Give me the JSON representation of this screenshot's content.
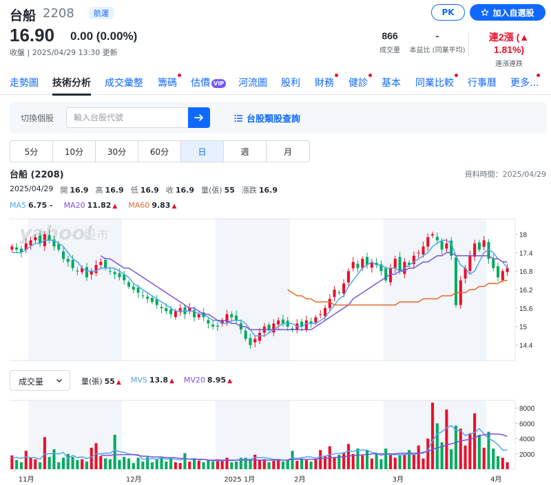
{
  "header": {
    "name": "台船",
    "code": "2208",
    "sector": "航運",
    "price": "16.90",
    "change": "0.00 (0.00%)",
    "close_time": "收盤 | 2025/04/29 13:30 更新",
    "pk_label": "PK",
    "watchlist_label": "加入自選股",
    "stats": [
      {
        "value": "866",
        "label": "成交量"
      },
      {
        "value": "-",
        "label": "本益比 (同業平均)"
      },
      {
        "value": "連2漲 (▲ 1.81%)",
        "label": "連漲連跌"
      }
    ]
  },
  "tabs": [
    {
      "label": "走勢圖",
      "dot": false
    },
    {
      "label": "技術分析",
      "dot": false,
      "active": true
    },
    {
      "label": "成交彙整",
      "dot": false
    },
    {
      "label": "籌碼",
      "dot": true
    },
    {
      "label": "估價",
      "dot": false,
      "vip": "VIP"
    },
    {
      "label": "河流圖",
      "dot": false
    },
    {
      "label": "股利",
      "dot": false
    },
    {
      "label": "財務",
      "dot": true
    },
    {
      "label": "健診",
      "dot": true
    },
    {
      "label": "基本",
      "dot": false
    },
    {
      "label": "同業比較",
      "dot": true
    },
    {
      "label": "行事曆",
      "dot": false
    },
    {
      "label": "更多...",
      "dot": true
    }
  ],
  "search": {
    "label": "切換個股",
    "placeholder": "輸入台股代號",
    "category_link": "台股類股查詢"
  },
  "periods": [
    {
      "label": "5分"
    },
    {
      "label": "10分"
    },
    {
      "label": "30分"
    },
    {
      "label": "60分"
    },
    {
      "label": "日",
      "active": true
    },
    {
      "label": "週"
    },
    {
      "label": "月"
    }
  ],
  "chart_header": {
    "title": "台船 (2208)",
    "data_time": "資料時間：2025/04/29",
    "date": "2025/04/29",
    "open_label": "開",
    "open": "16.9",
    "high_label": "高",
    "high": "16.9",
    "low_label": "低",
    "low": "16.9",
    "close_label": "收",
    "close": "16.9",
    "vol_label": "量(張)",
    "vol": "55",
    "chg_label": "漲跌",
    "chg": "16.9",
    "ma5_label": "MA5",
    "ma5": "6.75 -",
    "ma20_label": "MA20",
    "ma20": "11.82",
    "ma60_label": "MA60",
    "ma60": "9.83",
    "up_arrow": "▲"
  },
  "volume_header": {
    "select_label": "成交量",
    "vol_label": "量(張)",
    "vol": "55",
    "mv5_label": "MV5",
    "mv5": "13.8",
    "mv20_label": "MV20",
    "mv20": "8.95"
  },
  "watermark": {
    "brand": "yahoo!",
    "sub": "股市"
  },
  "colors": {
    "up": "#eb0f29",
    "down": "#00ab5e",
    "ma5": "#4fa4f1",
    "ma20": "#7b52d8",
    "ma60": "#e2672c",
    "accent": "#0f69ff"
  },
  "chart_data": [
    {
      "type": "candlestick",
      "title": "台船 (2208)",
      "x_ticks": [
        "11月",
        "12月",
        "2025 1月",
        "2月",
        "3月",
        "4月"
      ],
      "y_ticks": [
        14.4,
        15,
        15.6,
        16.2,
        16.8,
        17.4,
        18
      ],
      "ylim": [
        13.9,
        18.5
      ],
      "close": [
        17.6,
        17.5,
        17.4,
        17.7,
        17.8,
        17.9,
        17.7,
        18.0,
        17.8,
        17.6,
        17.5,
        17.2,
        17.1,
        16.9,
        16.8,
        16.9,
        16.6,
        16.8,
        17.0,
        17.1,
        16.9,
        16.8,
        16.7,
        16.6,
        16.5,
        16.3,
        16.2,
        16.1,
        16.0,
        15.9,
        15.8,
        15.7,
        15.6,
        15.5,
        15.4,
        15.5,
        15.6,
        15.4,
        15.6,
        15.3,
        15.4,
        15.3,
        15.1,
        15.0,
        15.0,
        15.2,
        15.4,
        15.3,
        15.2,
        14.9,
        14.6,
        14.4,
        14.6,
        14.8,
        15.0,
        14.9,
        15.1,
        15.2,
        15.1,
        15.0,
        14.9,
        15.1,
        15.0,
        15.2,
        15.1,
        15.3,
        15.4,
        15.6,
        15.9,
        16.2,
        16.1,
        16.4,
        16.8,
        17.1,
        16.9,
        17.2,
        17.0,
        17.1,
        17.0,
        16.8,
        16.5,
        16.9,
        17.2,
        16.8,
        17.1,
        17.0,
        17.3,
        17.4,
        17.6,
        17.9,
        18.0,
        17.8,
        17.5,
        17.7,
        17.3,
        15.7,
        16.5,
        16.9,
        17.3,
        17.7,
        17.5,
        17.8,
        17.2,
        16.9,
        16.6,
        16.8,
        16.9
      ],
      "series": [
        {
          "name": "MA5",
          "values": [
            17.4,
            17.4,
            17.4,
            17.5,
            17.6,
            17.7,
            17.7,
            17.8,
            17.8,
            17.8,
            17.7,
            17.6,
            17.4,
            17.2,
            17.1,
            16.9,
            16.8,
            16.8,
            16.8,
            16.9,
            16.9,
            16.9,
            16.9,
            16.8,
            16.7,
            16.6,
            16.4,
            16.3,
            16.2,
            16.1,
            16.0,
            15.9,
            15.8,
            15.7,
            15.6,
            15.5,
            15.5,
            15.5,
            15.5,
            15.5,
            15.4,
            15.4,
            15.3,
            15.2,
            15.2,
            15.1,
            15.1,
            15.2,
            15.2,
            15.2,
            15.1,
            14.9,
            14.7,
            14.7,
            14.7,
            14.8,
            14.9,
            15.0,
            15.1,
            15.1,
            15.1,
            15.0,
            15.0,
            15.1,
            15.1,
            15.1,
            15.2,
            15.3,
            15.5,
            15.7,
            15.9,
            16.0,
            16.3,
            16.5,
            16.7,
            16.9,
            17.0,
            17.1,
            17.0,
            17.0,
            16.9,
            16.9,
            16.9,
            16.8,
            16.9,
            17.0,
            17.1,
            17.2,
            17.3,
            17.4,
            17.6,
            17.7,
            17.8,
            17.8,
            17.7,
            17.3,
            17.0,
            16.9,
            16.7,
            16.8,
            17.1,
            17.4,
            17.5,
            17.4,
            17.2,
            17.1,
            16.9
          ]
        },
        {
          "name": "MA20",
          "values": [
            null,
            null,
            null,
            null,
            null,
            null,
            null,
            null,
            null,
            null,
            null,
            null,
            null,
            null,
            null,
            null,
            null,
            null,
            null,
            17.3,
            17.2,
            17.2,
            17.1,
            17.0,
            16.9,
            16.9,
            16.8,
            16.7,
            16.6,
            16.5,
            16.4,
            16.3,
            16.2,
            16.1,
            16.0,
            15.9,
            15.8,
            15.7,
            15.6,
            15.6,
            15.5,
            15.4,
            15.4,
            15.3,
            15.2,
            15.2,
            15.2,
            15.1,
            15.1,
            15.0,
            15.0,
            14.9,
            14.9,
            14.9,
            14.9,
            14.9,
            14.9,
            14.9,
            14.9,
            14.9,
            14.9,
            14.9,
            14.9,
            14.9,
            14.9,
            15.0,
            15.1,
            15.2,
            15.3,
            15.4,
            15.5,
            15.6,
            15.7,
            15.9,
            16.0,
            16.1,
            16.2,
            16.3,
            16.4,
            16.5,
            16.6,
            16.7,
            16.7,
            16.8,
            16.8,
            16.9,
            16.9,
            17.0,
            17.1,
            17.1,
            17.2,
            17.3,
            17.3,
            17.4,
            17.4,
            17.3,
            17.3,
            17.3,
            17.3,
            17.3,
            17.3,
            17.3,
            17.3,
            17.2,
            17.2,
            17.1,
            17.1
          ]
        },
        {
          "name": "MA60",
          "values": [
            null,
            null,
            null,
            null,
            null,
            null,
            null,
            null,
            null,
            null,
            null,
            null,
            null,
            null,
            null,
            null,
            null,
            null,
            null,
            null,
            null,
            null,
            null,
            null,
            null,
            null,
            null,
            null,
            null,
            null,
            null,
            null,
            null,
            null,
            null,
            null,
            null,
            null,
            null,
            null,
            null,
            null,
            null,
            null,
            null,
            null,
            null,
            null,
            null,
            null,
            null,
            null,
            null,
            null,
            null,
            null,
            null,
            null,
            null,
            16.2,
            16.1,
            16.0,
            16.0,
            15.9,
            15.9,
            15.8,
            15.8,
            15.8,
            15.8,
            15.7,
            15.7,
            15.7,
            15.7,
            15.7,
            15.7,
            15.7,
            15.7,
            15.7,
            15.7,
            15.7,
            15.7,
            15.7,
            15.7,
            15.8,
            15.8,
            15.8,
            15.8,
            15.8,
            15.9,
            15.9,
            15.9,
            15.9,
            16.0,
            16.0,
            16.0,
            16.1,
            16.1,
            16.1,
            16.2,
            16.2,
            16.3,
            16.3,
            16.4,
            16.4,
            16.4,
            16.5,
            16.5
          ]
        }
      ]
    },
    {
      "type": "bar",
      "title": "成交量",
      "y_ticks": [
        2000,
        4000,
        6000,
        8000
      ],
      "ylim": [
        0,
        9000
      ],
      "values": [
        1800,
        1200,
        900,
        2400,
        1500,
        1300,
        900,
        4200,
        1600,
        2600,
        900,
        1500,
        2000,
        1600,
        1200,
        1300,
        1000,
        2800,
        3400,
        1700,
        1400,
        1300,
        4500,
        1200,
        1600,
        1400,
        800,
        1500,
        1000,
        1600,
        900,
        1300,
        1600,
        1000,
        1500,
        900,
        800,
        2100,
        1000,
        1300,
        1100,
        900,
        1200,
        1000,
        1300,
        1100,
        1500,
        900,
        1000,
        1500,
        1500,
        1300,
        1900,
        1200,
        1300,
        900,
        1100,
        1300,
        1000,
        1200,
        2400,
        1100,
        1400,
        1200,
        1000,
        1300,
        2500,
        1700,
        3000,
        1600,
        1900,
        2200,
        3300,
        2000,
        2700,
        1800,
        2500,
        1400,
        2100,
        1300,
        2700,
        2000,
        1500,
        1800,
        1900,
        2500,
        1900,
        3100,
        1400,
        4000,
        8700,
        6000,
        3500,
        7800,
        2600,
        5700,
        5300,
        3100,
        4700,
        7300,
        4500,
        2800,
        4900,
        2700,
        1700,
        1500,
        900
      ],
      "series": [
        {
          "name": "MV5",
          "values": [
            1500,
            1500,
            1400,
            1600,
            1500,
            1500,
            1300,
            2000,
            2000,
            2100,
            2000,
            2200,
            1400,
            1800,
            1500,
            1600,
            1400,
            1600,
            2000,
            2000,
            2100,
            2100,
            2500,
            2300,
            2200,
            2000,
            1900,
            1900,
            1300,
            1300,
            1400,
            1300,
            1500,
            1300,
            1400,
            1300,
            1200,
            1400,
            1300,
            1400,
            1200,
            1300,
            1200,
            1100,
            1100,
            1100,
            1200,
            1100,
            1200,
            1300,
            1300,
            1300,
            1500,
            1500,
            1500,
            1400,
            1300,
            1300,
            1200,
            1200,
            1500,
            1400,
            1500,
            1600,
            1600,
            1400,
            1700,
            1700,
            1900,
            2000,
            2100,
            2100,
            2400,
            2300,
            2500,
            2500,
            2500,
            2200,
            2100,
            1800,
            2000,
            1900,
            1900,
            1900,
            1900,
            2000,
            1900,
            2100,
            2100,
            2500,
            3700,
            4600,
            4900,
            5400,
            5700,
            5100,
            5000,
            4400,
            4600,
            4800,
            5300,
            4600,
            4000,
            3700,
            3200,
            2500,
            2500
          ]
        },
        {
          "name": "MV20",
          "values": [
            null,
            null,
            null,
            null,
            null,
            null,
            null,
            null,
            null,
            null,
            null,
            null,
            null,
            null,
            null,
            null,
            null,
            null,
            null,
            1800,
            1800,
            1800,
            1900,
            1900,
            1900,
            1900,
            1900,
            1800,
            1700,
            1700,
            1600,
            1600,
            1600,
            1500,
            1500,
            1500,
            1400,
            1400,
            1300,
            1300,
            1300,
            1300,
            1200,
            1200,
            1200,
            1200,
            1200,
            1200,
            1200,
            1200,
            1200,
            1200,
            1200,
            1200,
            1200,
            1200,
            1200,
            1200,
            1200,
            1200,
            1300,
            1300,
            1300,
            1300,
            1300,
            1300,
            1400,
            1400,
            1500,
            1500,
            1600,
            1600,
            1700,
            1800,
            1800,
            1900,
            1900,
            2000,
            2000,
            2000,
            2000,
            2000,
            2000,
            2100,
            2100,
            2100,
            2100,
            2100,
            2200,
            2300,
            2600,
            2800,
            2900,
            3200,
            3300,
            3500,
            3700,
            3800,
            3900,
            4100,
            4400,
            4500,
            4600,
            4600,
            4600,
            4500,
            4300
          ]
        }
      ]
    }
  ]
}
